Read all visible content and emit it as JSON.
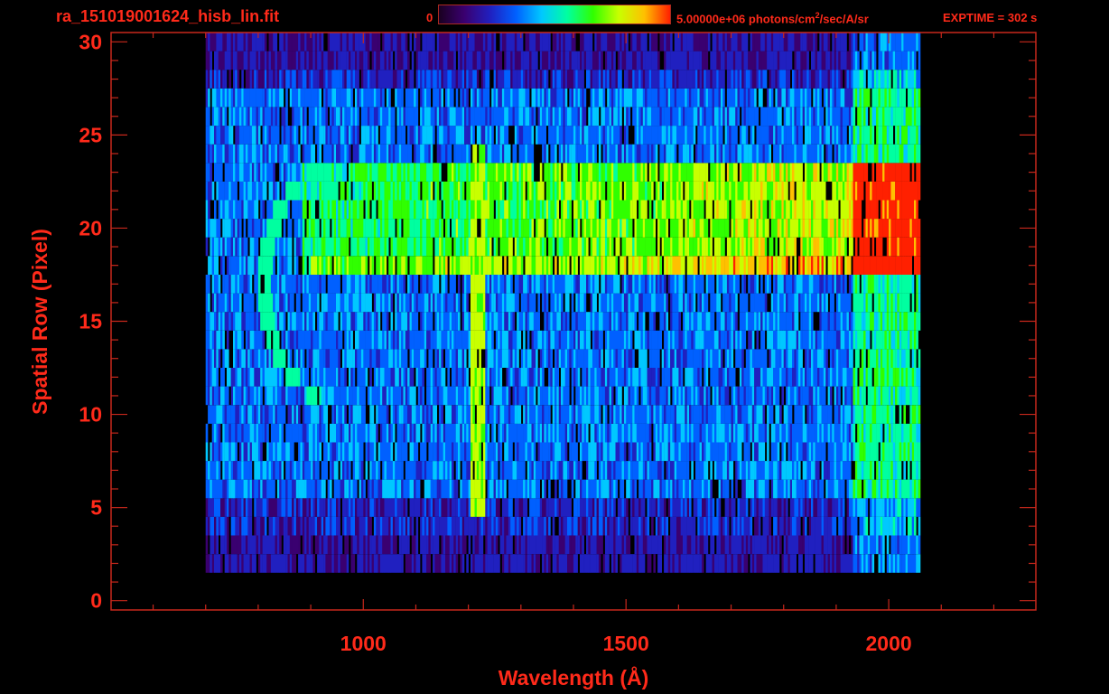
{
  "header": {
    "file_name": "ra_151019001624_hisb_lin.fit",
    "colorbar_min": "0",
    "colorbar_max_value": "5.00000e+06 photons/cm",
    "colorbar_max_exp": "2",
    "colorbar_max_unit": "/sec/A/sr",
    "exposure": "EXPTIME = 302 s"
  },
  "colors": {
    "axis": "#ff2a1a",
    "frame": "#c8281c",
    "background": "#000000",
    "colormap": [
      "#1a0020",
      "#3a0070",
      "#2020c0",
      "#0060ff",
      "#00c8ff",
      "#00ffa0",
      "#30ff00",
      "#c8ff00",
      "#ffc000",
      "#ff2000"
    ]
  },
  "chart_data": {
    "type": "heatmap",
    "title": "",
    "xlabel": "Wavelength (Å)",
    "ylabel": "Spatial Row (Pixel)",
    "xlim": [
      520,
      2280
    ],
    "ylim": [
      -0.5,
      30.5
    ],
    "x_ticks": [
      1000,
      1500,
      2000
    ],
    "y_ticks": [
      0,
      5,
      10,
      15,
      20,
      25,
      30
    ],
    "grid": false,
    "colorbar": {
      "min": 0,
      "max": 5000000,
      "unit": "photons/cm^2/sec/A/sr"
    },
    "data_extent": {
      "x_start": 700,
      "x_end": 2060,
      "rows": [
        2,
        30
      ]
    },
    "features": [
      {
        "name": "Lyman-alpha emission line",
        "x": 1216,
        "rows": [
          5,
          24
        ]
      },
      {
        "name": "bright horizontal band",
        "rows": [
          18,
          23
        ],
        "x": [
          870,
          2060
        ]
      },
      {
        "name": "curved arc",
        "rows": [
          11,
          23
        ],
        "x": [
          800,
          960
        ]
      }
    ]
  }
}
